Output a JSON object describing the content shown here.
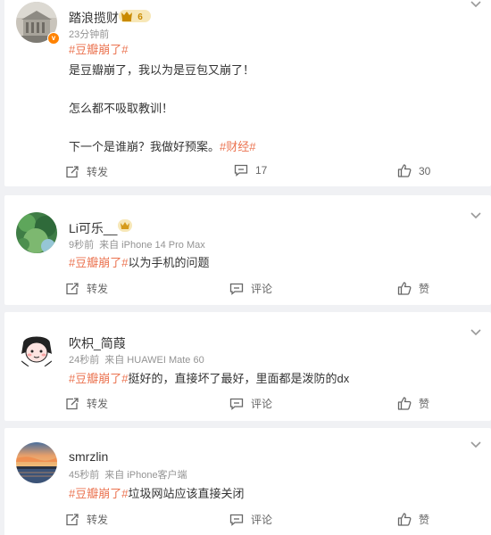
{
  "posts": [
    {
      "username": "踏浪揽财",
      "vip_level": "6",
      "time": "23分钟前",
      "device": "",
      "verified_badge": "v",
      "paragraphs": [
        {
          "tag": "#豆瓣崩了#",
          "text": ""
        },
        {
          "tag": "",
          "text": "是豆瓣崩了，我以为是豆包又崩了！"
        },
        {
          "tag": "",
          "text": "怎么都不吸取教训！"
        },
        {
          "tag": "",
          "text": "下一个是谁崩？我做好预案。",
          "tag_after": "#财经#"
        }
      ],
      "actions": {
        "repost": "转发",
        "comment": "17",
        "like": "30"
      },
      "avatar": "building-photo",
      "badge_icon": "crown-vip-icon"
    },
    {
      "username": "Li可乐__",
      "time": "9秒前",
      "device": "来自 iPhone 14 Pro Max",
      "paragraphs": [
        {
          "tag": "#豆瓣崩了#",
          "text": "以为手机的问题"
        }
      ],
      "actions": {
        "repost": "转发",
        "comment": "评论",
        "like": "赞"
      },
      "avatar": "green-nature-photo",
      "badge_icon": "crown-icon"
    },
    {
      "username": "吹枳_简葭",
      "time": "24秒前",
      "device": "来自 HUAWEI Mate 60",
      "paragraphs": [
        {
          "tag": "#豆瓣崩了#",
          "text": "挺好的，直接坏了最好，里面都是泼防的dx"
        }
      ],
      "actions": {
        "repost": "转发",
        "comment": "评论",
        "like": "赞"
      },
      "avatar": "cartoon-girl-drawing"
    },
    {
      "username": "smrzlin",
      "time": "45秒前",
      "device": "来自 iPhone客户端",
      "paragraphs": [
        {
          "tag": "#豆瓣崩了#",
          "text": "垃圾网站应该直接关闭"
        }
      ],
      "actions": {
        "repost": "转发",
        "comment": "评论",
        "like": "赞"
      },
      "avatar": "sunset-lake-photo"
    }
  ],
  "colors": {
    "background": "#f0f1f4",
    "card": "#ffffff",
    "tag": "#eb7350",
    "meta": "#939393",
    "vip": "#f0a100"
  }
}
